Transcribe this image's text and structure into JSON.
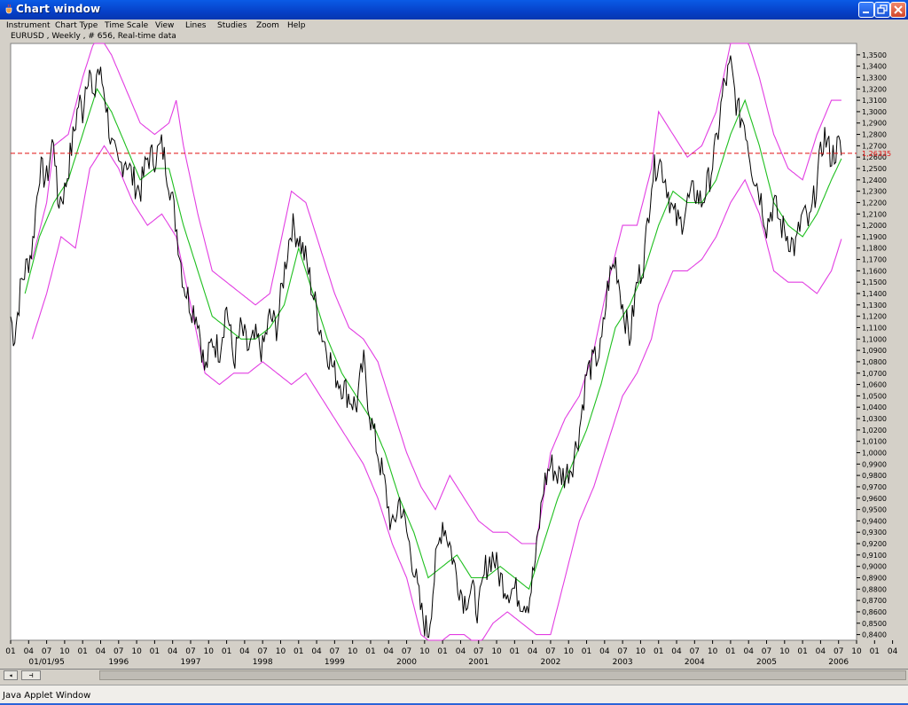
{
  "window": {
    "title": "Chart window",
    "controls": [
      "minimize-button",
      "restore-button",
      "close-button"
    ]
  },
  "menu": {
    "items": [
      "Instrument",
      "Chart Type",
      "Time Scale",
      "View",
      "Lines",
      "Studies",
      "Zoom",
      "Help"
    ]
  },
  "chart_info": {
    "subtitle": "EURUSD , Weekly , # 656, Real-time data"
  },
  "colors": {
    "price_line": "#000000",
    "moving_average": "#1fbf1f",
    "bands": "#e23ee2",
    "reference_line": "#e01010",
    "reference_label": "#e01010",
    "plot_background": "#ffffff",
    "window_background": "#d4d0c8"
  },
  "chart_data": {
    "type": "line",
    "instrument": "EURUSD",
    "timeframe": "Weekly",
    "ylim": [
      0.835,
      1.36
    ],
    "y_tick_step": 0.01,
    "y_tick_labels": [
      "1,3500",
      "1,3400",
      "1,3300",
      "1,3200",
      "1,3100",
      "1,3000",
      "1,2900",
      "1,2800",
      "1,2700",
      "1,2600",
      "1,2500",
      "1,2400",
      "1,2300",
      "1,2200",
      "1,2100",
      "1,2000",
      "1,1900",
      "1,1800",
      "1,1700",
      "1,1600",
      "1,1500",
      "1,1400",
      "1,1300",
      "1,1200",
      "1,1100",
      "1,1000",
      "1,0900",
      "1,0800",
      "1,0700",
      "1,0600",
      "1,0500",
      "1,0400",
      "1,0300",
      "1,0200",
      "1,0100",
      "1,0000",
      "0,9900",
      "0,9800",
      "0,9700",
      "0,9600",
      "0,9500",
      "0,9400",
      "0,9300",
      "0,9200",
      "0,9100",
      "0,9000",
      "0,8900",
      "0,8800",
      "0,8700",
      "0,8600",
      "0,8500",
      "0,8400"
    ],
    "x_range": [
      1995.0,
      2006.75
    ],
    "x_month_labels": [
      "01",
      "04",
      "07",
      "10",
      "01",
      "04",
      "07",
      "10",
      "01",
      "04",
      "07",
      "10",
      "01",
      "04",
      "07",
      "10",
      "01",
      "04",
      "07",
      "10",
      "01",
      "04",
      "07",
      "10",
      "01",
      "04",
      "07",
      "10",
      "01",
      "04",
      "07",
      "10",
      "01",
      "04",
      "07",
      "10",
      "01",
      "04",
      "07",
      "10",
      "01",
      "04",
      "07",
      "10",
      "01",
      "04",
      "07",
      "10",
      "01",
      "04"
    ],
    "x_year_labels": [
      {
        "x": 1995.5,
        "label": "01/01/95"
      },
      {
        "x": 1996.5,
        "label": "1996"
      },
      {
        "x": 1997.5,
        "label": "1997"
      },
      {
        "x": 1998.5,
        "label": "1998"
      },
      {
        "x": 1999.5,
        "label": "1999"
      },
      {
        "x": 2000.5,
        "label": "2000"
      },
      {
        "x": 2001.5,
        "label": "2001"
      },
      {
        "x": 2002.5,
        "label": "2002"
      },
      {
        "x": 2003.5,
        "label": "2003"
      },
      {
        "x": 2004.5,
        "label": "2004"
      },
      {
        "x": 2005.5,
        "label": "2005"
      },
      {
        "x": 2006.5,
        "label": "2006"
      }
    ],
    "reference_line": {
      "value": 1.26335,
      "label": "1,26335"
    },
    "price_anchors": [
      [
        1995.0,
        1.12
      ],
      [
        1995.05,
        1.1
      ],
      [
        1995.15,
        1.15
      ],
      [
        1995.3,
        1.18
      ],
      [
        1995.4,
        1.25
      ],
      [
        1995.5,
        1.24
      ],
      [
        1995.6,
        1.28
      ],
      [
        1995.65,
        1.22
      ],
      [
        1995.75,
        1.23
      ],
      [
        1995.85,
        1.27
      ],
      [
        1995.9,
        1.29
      ],
      [
        1995.95,
        1.31
      ],
      [
        1996.0,
        1.3
      ],
      [
        1996.05,
        1.33
      ],
      [
        1996.1,
        1.34
      ],
      [
        1996.15,
        1.3
      ],
      [
        1996.2,
        1.34
      ],
      [
        1996.3,
        1.32
      ],
      [
        1996.4,
        1.27
      ],
      [
        1996.5,
        1.25
      ],
      [
        1996.6,
        1.26
      ],
      [
        1996.7,
        1.24
      ],
      [
        1996.8,
        1.23
      ],
      [
        1996.9,
        1.26
      ],
      [
        1997.0,
        1.26
      ],
      [
        1997.1,
        1.27
      ],
      [
        1997.2,
        1.24
      ],
      [
        1997.3,
        1.2
      ],
      [
        1997.4,
        1.15
      ],
      [
        1997.5,
        1.13
      ],
      [
        1997.6,
        1.12
      ],
      [
        1997.7,
        1.07
      ],
      [
        1997.8,
        1.1
      ],
      [
        1997.9,
        1.09
      ],
      [
        1998.0,
        1.13
      ],
      [
        1998.1,
        1.08
      ],
      [
        1998.2,
        1.11
      ],
      [
        1998.3,
        1.09
      ],
      [
        1998.4,
        1.1
      ],
      [
        1998.5,
        1.09
      ],
      [
        1998.6,
        1.12
      ],
      [
        1998.7,
        1.11
      ],
      [
        1998.8,
        1.16
      ],
      [
        1998.9,
        1.2
      ],
      [
        1999.0,
        1.19
      ],
      [
        1999.1,
        1.17
      ],
      [
        1999.2,
        1.14
      ],
      [
        1999.3,
        1.11
      ],
      [
        1999.4,
        1.09
      ],
      [
        1999.5,
        1.07
      ],
      [
        1999.6,
        1.06
      ],
      [
        1999.7,
        1.05
      ],
      [
        1999.8,
        1.04
      ],
      [
        1999.9,
        1.08
      ],
      [
        2000.0,
        1.03
      ],
      [
        2000.1,
        1.0
      ],
      [
        2000.2,
        0.97
      ],
      [
        2000.3,
        0.93
      ],
      [
        2000.4,
        0.96
      ],
      [
        2000.5,
        0.93
      ],
      [
        2000.6,
        0.9
      ],
      [
        2000.7,
        0.86
      ],
      [
        2000.8,
        0.84
      ],
      [
        2000.9,
        0.9
      ],
      [
        2001.0,
        0.94
      ],
      [
        2001.1,
        0.92
      ],
      [
        2001.2,
        0.89
      ],
      [
        2001.3,
        0.87
      ],
      [
        2001.4,
        0.88
      ],
      [
        2001.5,
        0.86
      ],
      [
        2001.6,
        0.9
      ],
      [
        2001.7,
        0.91
      ],
      [
        2001.8,
        0.89
      ],
      [
        2001.9,
        0.88
      ],
      [
        2002.0,
        0.88
      ],
      [
        2002.1,
        0.87
      ],
      [
        2002.2,
        0.87
      ],
      [
        2002.3,
        0.91
      ],
      [
        2002.4,
        0.97
      ],
      [
        2002.5,
        0.99
      ],
      [
        2002.6,
        0.98
      ],
      [
        2002.7,
        0.98
      ],
      [
        2002.8,
        0.99
      ],
      [
        2002.9,
        1.02
      ],
      [
        2003.0,
        1.07
      ],
      [
        2003.1,
        1.08
      ],
      [
        2003.2,
        1.09
      ],
      [
        2003.3,
        1.15
      ],
      [
        2003.4,
        1.17
      ],
      [
        2003.5,
        1.13
      ],
      [
        2003.6,
        1.1
      ],
      [
        2003.7,
        1.15
      ],
      [
        2003.8,
        1.17
      ],
      [
        2003.9,
        1.24
      ],
      [
        2004.0,
        1.26
      ],
      [
        2004.1,
        1.24
      ],
      [
        2004.2,
        1.21
      ],
      [
        2004.3,
        1.2
      ],
      [
        2004.4,
        1.22
      ],
      [
        2004.5,
        1.23
      ],
      [
        2004.6,
        1.22
      ],
      [
        2004.7,
        1.24
      ],
      [
        2004.8,
        1.27
      ],
      [
        2004.9,
        1.32
      ],
      [
        2005.0,
        1.34
      ],
      [
        2005.1,
        1.3
      ],
      [
        2005.2,
        1.29
      ],
      [
        2005.3,
        1.25
      ],
      [
        2005.4,
        1.23
      ],
      [
        2005.5,
        1.2
      ],
      [
        2005.6,
        1.22
      ],
      [
        2005.7,
        1.2
      ],
      [
        2005.8,
        1.19
      ],
      [
        2005.9,
        1.18
      ],
      [
        2006.0,
        1.21
      ],
      [
        2006.1,
        1.2
      ],
      [
        2006.2,
        1.24
      ],
      [
        2006.3,
        1.28
      ],
      [
        2006.4,
        1.26
      ],
      [
        2006.5,
        1.27
      ],
      [
        2006.55,
        1.26
      ]
    ],
    "moving_average_anchors": [
      [
        1995.2,
        1.14
      ],
      [
        1995.4,
        1.19
      ],
      [
        1995.6,
        1.22
      ],
      [
        1995.8,
        1.24
      ],
      [
        1996.0,
        1.28
      ],
      [
        1996.2,
        1.32
      ],
      [
        1996.4,
        1.3
      ],
      [
        1996.6,
        1.27
      ],
      [
        1996.8,
        1.24
      ],
      [
        1997.0,
        1.25
      ],
      [
        1997.2,
        1.25
      ],
      [
        1997.4,
        1.2
      ],
      [
        1997.6,
        1.16
      ],
      [
        1997.8,
        1.12
      ],
      [
        1998.0,
        1.11
      ],
      [
        1998.2,
        1.1
      ],
      [
        1998.4,
        1.1
      ],
      [
        1998.6,
        1.11
      ],
      [
        1998.8,
        1.13
      ],
      [
        1999.0,
        1.18
      ],
      [
        1999.2,
        1.14
      ],
      [
        1999.4,
        1.1
      ],
      [
        1999.6,
        1.07
      ],
      [
        1999.8,
        1.05
      ],
      [
        2000.0,
        1.03
      ],
      [
        2000.2,
        1.0
      ],
      [
        2000.4,
        0.96
      ],
      [
        2000.6,
        0.93
      ],
      [
        2000.8,
        0.89
      ],
      [
        2001.0,
        0.9
      ],
      [
        2001.2,
        0.91
      ],
      [
        2001.4,
        0.89
      ],
      [
        2001.6,
        0.89
      ],
      [
        2001.8,
        0.9
      ],
      [
        2002.0,
        0.89
      ],
      [
        2002.2,
        0.88
      ],
      [
        2002.4,
        0.92
      ],
      [
        2002.6,
        0.96
      ],
      [
        2002.8,
        0.99
      ],
      [
        2003.0,
        1.02
      ],
      [
        2003.2,
        1.06
      ],
      [
        2003.4,
        1.11
      ],
      [
        2003.6,
        1.13
      ],
      [
        2003.8,
        1.16
      ],
      [
        2004.0,
        1.2
      ],
      [
        2004.2,
        1.23
      ],
      [
        2004.4,
        1.22
      ],
      [
        2004.6,
        1.22
      ],
      [
        2004.8,
        1.24
      ],
      [
        2005.0,
        1.28
      ],
      [
        2005.2,
        1.31
      ],
      [
        2005.4,
        1.27
      ],
      [
        2005.6,
        1.22
      ],
      [
        2005.8,
        1.2
      ],
      [
        2006.0,
        1.19
      ],
      [
        2006.2,
        1.21
      ],
      [
        2006.4,
        1.24
      ],
      [
        2006.55,
        1.26
      ]
    ],
    "upper_band_anchors": [
      [
        1995.3,
        1.17
      ],
      [
        1995.5,
        1.22
      ],
      [
        1995.6,
        1.27
      ],
      [
        1995.8,
        1.28
      ],
      [
        1996.0,
        1.33
      ],
      [
        1996.2,
        1.37
      ],
      [
        1996.4,
        1.35
      ],
      [
        1996.6,
        1.32
      ],
      [
        1996.8,
        1.29
      ],
      [
        1997.0,
        1.28
      ],
      [
        1997.2,
        1.29
      ],
      [
        1997.3,
        1.31
      ],
      [
        1997.4,
        1.27
      ],
      [
        1997.6,
        1.21
      ],
      [
        1997.8,
        1.16
      ],
      [
        1998.0,
        1.15
      ],
      [
        1998.2,
        1.14
      ],
      [
        1998.4,
        1.13
      ],
      [
        1998.6,
        1.14
      ],
      [
        1998.8,
        1.2
      ],
      [
        1998.9,
        1.23
      ],
      [
        1999.1,
        1.22
      ],
      [
        1999.3,
        1.18
      ],
      [
        1999.5,
        1.14
      ],
      [
        1999.7,
        1.11
      ],
      [
        1999.9,
        1.1
      ],
      [
        2000.1,
        1.08
      ],
      [
        2000.3,
        1.04
      ],
      [
        2000.5,
        1.0
      ],
      [
        2000.7,
        0.97
      ],
      [
        2000.9,
        0.95
      ],
      [
        2001.1,
        0.98
      ],
      [
        2001.3,
        0.96
      ],
      [
        2001.5,
        0.94
      ],
      [
        2001.7,
        0.93
      ],
      [
        2001.9,
        0.93
      ],
      [
        2002.1,
        0.92
      ],
      [
        2002.3,
        0.92
      ],
      [
        2002.5,
        1.0
      ],
      [
        2002.7,
        1.03
      ],
      [
        2002.9,
        1.05
      ],
      [
        2003.1,
        1.09
      ],
      [
        2003.3,
        1.15
      ],
      [
        2003.5,
        1.2
      ],
      [
        2003.7,
        1.2
      ],
      [
        2003.9,
        1.25
      ],
      [
        2004.0,
        1.3
      ],
      [
        2004.2,
        1.28
      ],
      [
        2004.4,
        1.26
      ],
      [
        2004.6,
        1.27
      ],
      [
        2004.8,
        1.3
      ],
      [
        2005.0,
        1.36
      ],
      [
        2005.2,
        1.37
      ],
      [
        2005.4,
        1.33
      ],
      [
        2005.6,
        1.28
      ],
      [
        2005.8,
        1.25
      ],
      [
        2006.0,
        1.24
      ],
      [
        2006.2,
        1.28
      ],
      [
        2006.4,
        1.31
      ],
      [
        2006.55,
        1.31
      ]
    ],
    "lower_band_anchors": [
      [
        1995.3,
        1.1
      ],
      [
        1995.5,
        1.14
      ],
      [
        1995.7,
        1.19
      ],
      [
        1995.9,
        1.18
      ],
      [
        1996.1,
        1.25
      ],
      [
        1996.3,
        1.27
      ],
      [
        1996.5,
        1.25
      ],
      [
        1996.7,
        1.22
      ],
      [
        1996.9,
        1.2
      ],
      [
        1997.1,
        1.21
      ],
      [
        1997.3,
        1.19
      ],
      [
        1997.5,
        1.13
      ],
      [
        1997.7,
        1.07
      ],
      [
        1997.9,
        1.06
      ],
      [
        1998.1,
        1.07
      ],
      [
        1998.3,
        1.07
      ],
      [
        1998.5,
        1.08
      ],
      [
        1998.7,
        1.07
      ],
      [
        1998.9,
        1.06
      ],
      [
        1999.1,
        1.07
      ],
      [
        1999.3,
        1.05
      ],
      [
        1999.5,
        1.03
      ],
      [
        1999.7,
        1.01
      ],
      [
        1999.9,
        0.99
      ],
      [
        2000.1,
        0.96
      ],
      [
        2000.3,
        0.92
      ],
      [
        2000.5,
        0.89
      ],
      [
        2000.7,
        0.84
      ],
      [
        2000.9,
        0.83
      ],
      [
        2001.1,
        0.84
      ],
      [
        2001.3,
        0.84
      ],
      [
        2001.5,
        0.83
      ],
      [
        2001.7,
        0.85
      ],
      [
        2001.9,
        0.86
      ],
      [
        2002.1,
        0.85
      ],
      [
        2002.3,
        0.84
      ],
      [
        2002.5,
        0.84
      ],
      [
        2002.7,
        0.89
      ],
      [
        2002.9,
        0.94
      ],
      [
        2003.1,
        0.97
      ],
      [
        2003.3,
        1.01
      ],
      [
        2003.5,
        1.05
      ],
      [
        2003.7,
        1.07
      ],
      [
        2003.9,
        1.1
      ],
      [
        2004.0,
        1.13
      ],
      [
        2004.2,
        1.16
      ],
      [
        2004.4,
        1.16
      ],
      [
        2004.6,
        1.17
      ],
      [
        2004.8,
        1.19
      ],
      [
        2005.0,
        1.22
      ],
      [
        2005.2,
        1.24
      ],
      [
        2005.4,
        1.21
      ],
      [
        2005.6,
        1.16
      ],
      [
        2005.8,
        1.15
      ],
      [
        2006.0,
        1.15
      ],
      [
        2006.2,
        1.14
      ],
      [
        2006.4,
        1.16
      ],
      [
        2006.55,
        1.19
      ]
    ]
  },
  "status_bar": {
    "text": "Java Applet Window"
  }
}
